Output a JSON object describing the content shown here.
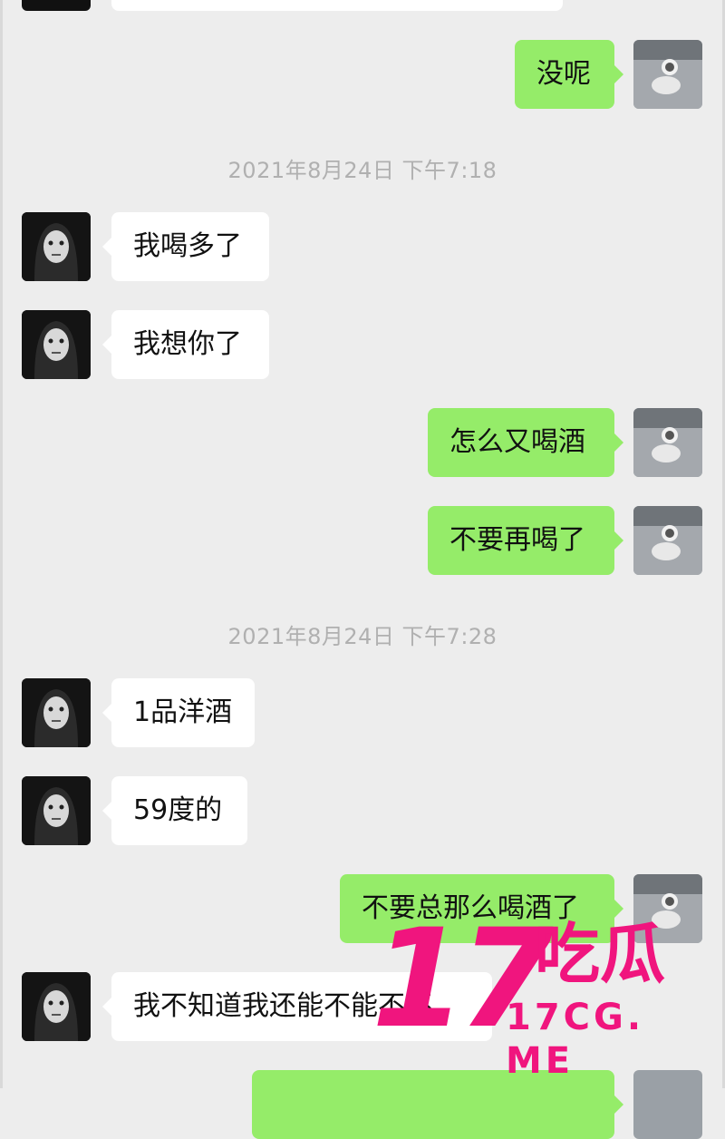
{
  "timestamps": [
    "2021年8月24日 下午7:18",
    "2021年8月24日 下午7:28"
  ],
  "messages": [
    {
      "side": "right",
      "text": "没呢"
    },
    {
      "side": "left",
      "text": "我喝多了"
    },
    {
      "side": "left",
      "text": "我想你了"
    },
    {
      "side": "right",
      "text": "怎么又喝酒"
    },
    {
      "side": "right",
      "text": "不要再喝了"
    },
    {
      "side": "left",
      "text": "1品洋酒"
    },
    {
      "side": "left",
      "text": "59度的"
    },
    {
      "side": "right",
      "text": "不要总那么喝酒了"
    },
    {
      "side": "left",
      "text": "我不知道我还能不能不不"
    }
  ],
  "watermark": {
    "number": "17",
    "chinese": "吃瓜",
    "url": "17CG. ME"
  },
  "colors": {
    "background": "#ededed",
    "sent_bubble": "#95ec69",
    "received_bubble": "#ffffff",
    "watermark": "#f0157e"
  }
}
